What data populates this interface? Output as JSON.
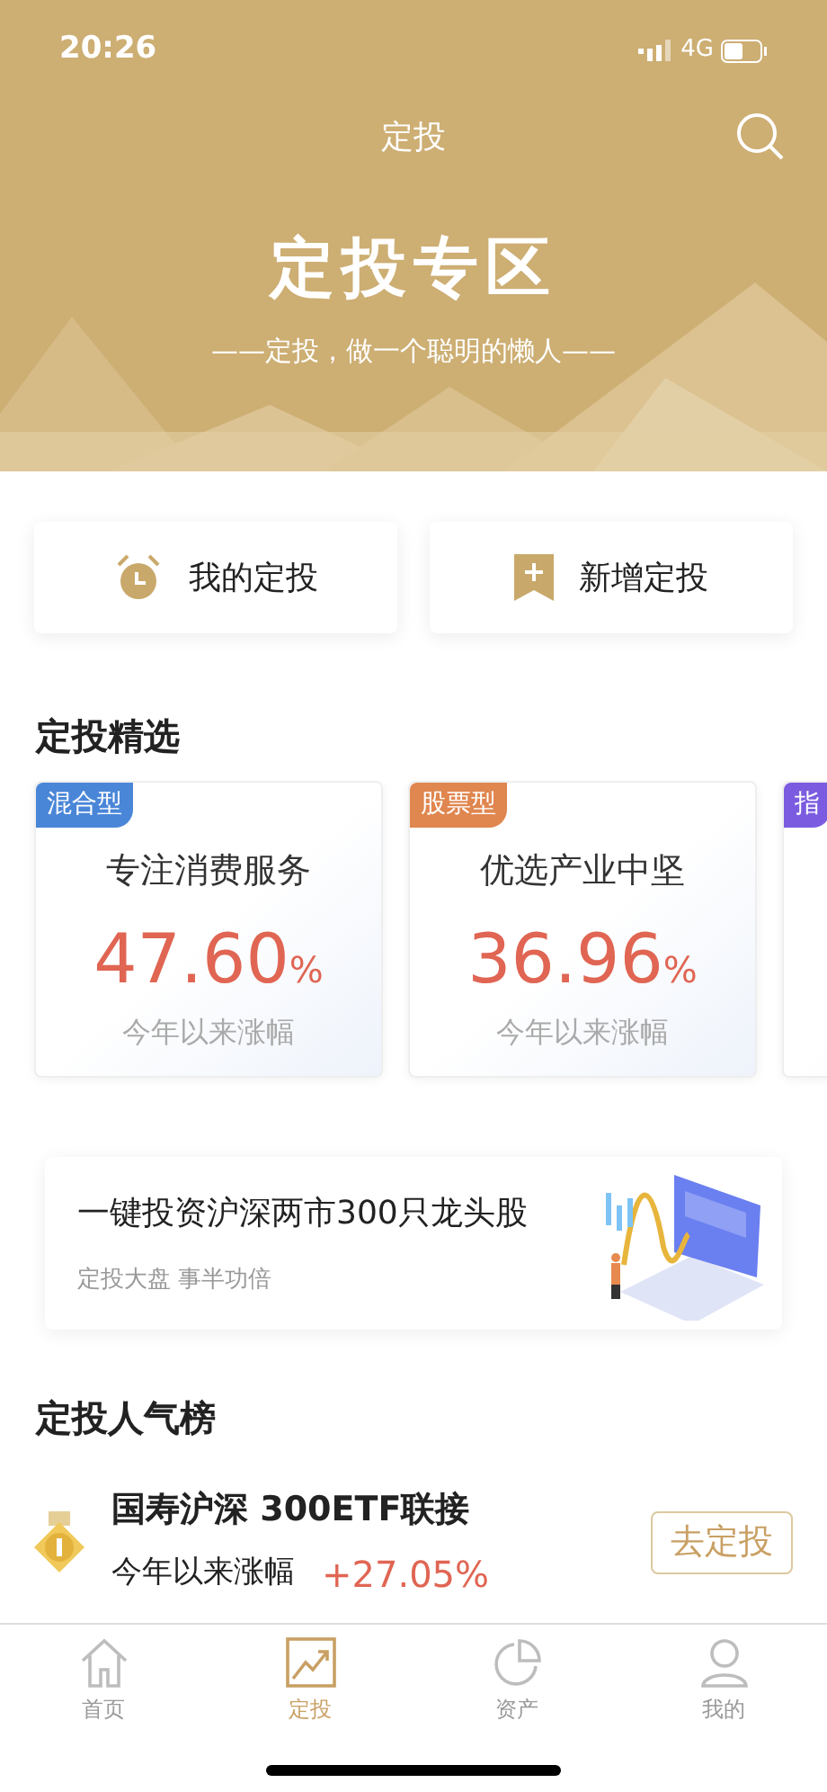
{
  "status_bar": {
    "time": "20:26",
    "network": "4G"
  },
  "nav": {
    "title": "定投"
  },
  "hero": {
    "title": "定投专区",
    "subtitle": "——定投，做一个聪明的懒人——"
  },
  "actions": [
    {
      "kind": "clock",
      "label": "我的定投"
    },
    {
      "kind": "bookmark",
      "label": "新增定投"
    }
  ],
  "featured": {
    "title": "定投精选",
    "cards": [
      {
        "tag": "混合型",
        "color": "#4a86d8",
        "name": "专注消费服务",
        "value": "47.60",
        "unit": "%",
        "caption": "今年以来涨幅"
      },
      {
        "tag": "股票型",
        "color": "#e0864f",
        "name": "优选产业中坚",
        "value": "36.96",
        "unit": "%",
        "caption": "今年以来涨幅"
      },
      {
        "tag": "指",
        "color": "#7b5ce0"
      }
    ]
  },
  "banner": {
    "title": "一键投资沪深两市300只龙头股",
    "subtitle": "定投大盘 事半功倍"
  },
  "ranking": {
    "title": "定投人气榜",
    "items": [
      {
        "name": "国寿沪深 300ETF联接",
        "caption": "今年以来涨幅",
        "value": "+27.05%",
        "button": "去定投"
      }
    ]
  },
  "tabs": [
    {
      "kind": "home",
      "label": "首页",
      "selected": false
    },
    {
      "kind": "chart",
      "label": "定投",
      "selected": true
    },
    {
      "kind": "pie",
      "label": "资产",
      "selected": false
    },
    {
      "kind": "user",
      "label": "我的",
      "selected": false
    }
  ]
}
